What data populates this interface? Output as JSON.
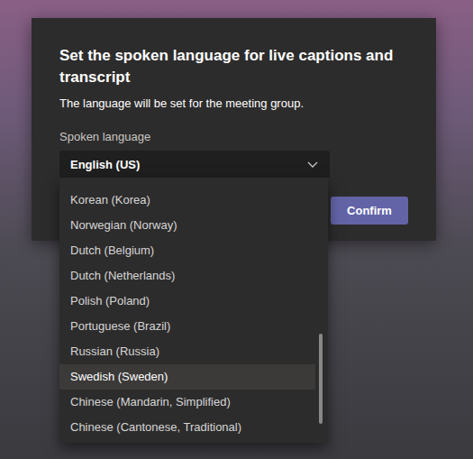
{
  "dialog": {
    "title": "Set the spoken language for live captions and transcript",
    "subtitle": "The language will be set for the meeting group.",
    "field_label": "Spoken language",
    "value": "English (US)",
    "expanded": true,
    "button": "Confirm"
  },
  "options": [
    {
      "label": "Korean (Korea)",
      "highlighted": false
    },
    {
      "label": "Norwegian (Norway)",
      "highlighted": false
    },
    {
      "label": "Dutch (Belgium)",
      "highlighted": false
    },
    {
      "label": "Dutch (Netherlands)",
      "highlighted": false
    },
    {
      "label": "Polish (Poland)",
      "highlighted": false
    },
    {
      "label": "Portuguese (Brazil)",
      "highlighted": false
    },
    {
      "label": "Russian (Russia)",
      "highlighted": false
    },
    {
      "label": "Swedish (Sweden)",
      "highlighted": true
    },
    {
      "label": "Chinese (Mandarin, Simplified)",
      "highlighted": false
    },
    {
      "label": "Chinese (Cantonese, Traditional)",
      "highlighted": false
    }
  ],
  "scrollbar": {
    "level": 0.9
  }
}
